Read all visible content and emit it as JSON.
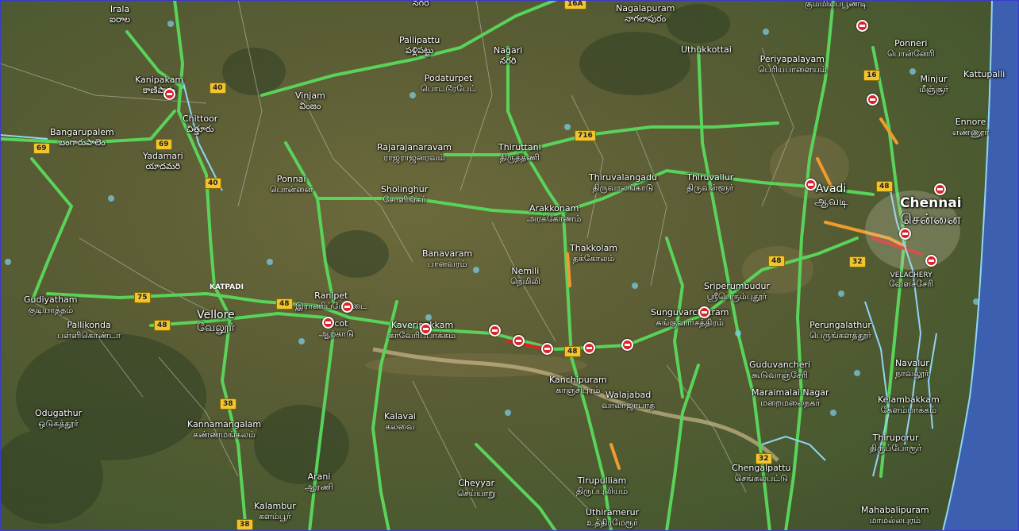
{
  "places": [
    {
      "id": "irala",
      "en": "Irala",
      "ta": "ఐరాల"
    },
    {
      "id": "pallipattu",
      "en": "Pallipattu",
      "ta": "పళ్లిపట్టు"
    },
    {
      "id": "nagari",
      "en": "Nagari",
      "ta": "నగరి"
    },
    {
      "id": "nagari-top",
      "en": "",
      "ta": "నగరి"
    },
    {
      "id": "nagalapuram",
      "en": "Nagalapuram",
      "ta": "నాగలాపురం"
    },
    {
      "id": "uthukkottai",
      "en": "Uthukkottai",
      "ta": ""
    },
    {
      "id": "kummidipundi",
      "en": "",
      "ta": "கும்மிடிப்பூண்டி"
    },
    {
      "id": "ponneri",
      "en": "Ponneri",
      "ta": "பொன்னேரி"
    },
    {
      "id": "periyapalayam",
      "en": "Periyapalayam",
      "ta": "பெரியபாளையம்"
    },
    {
      "id": "minjur",
      "en": "Minjur",
      "ta": "மீஞ்சூர்"
    },
    {
      "id": "kattupalli",
      "en": "Kattupalli",
      "ta": ""
    },
    {
      "id": "ennore",
      "en": "Ennore",
      "ta": "எண்ணூர்"
    },
    {
      "id": "kanipakam",
      "en": "Kanipakam",
      "ta": "కాణిపాకం"
    },
    {
      "id": "vinjam",
      "en": "Vinjam",
      "ta": "వింజం"
    },
    {
      "id": "podaturpet",
      "en": "Podaturpet",
      "ta": "பொடடூரபேட்"
    },
    {
      "id": "chittoor",
      "en": "Chittoor",
      "ta": "చిత్తూరు"
    },
    {
      "id": "bangarupalem",
      "en": "Bangarupalem",
      "ta": "బంగారుపాలెం"
    },
    {
      "id": "yadamari",
      "en": "Yadamari",
      "ta": "యాదమరి"
    },
    {
      "id": "rajarajanaravam",
      "en": "Rajarajanaravam",
      "ta": "ராஜராஜனரவம்"
    },
    {
      "id": "thiruttani",
      "en": "Thiruttani",
      "ta": "திருத்தணி"
    },
    {
      "id": "thiruvalangadu",
      "en": "Thiruvalangadu",
      "ta": "திருவாலங்காடு"
    },
    {
      "id": "thiruvallur",
      "en": "Thiruvallur",
      "ta": "திருவள்ளூர்"
    },
    {
      "id": "avadi",
      "en": "Avadi",
      "ta": "ஆவடி"
    },
    {
      "id": "chennai",
      "en": "Chennai",
      "ta": "சென்னை"
    },
    {
      "id": "ponnai",
      "en": "Ponnai",
      "ta": "பொன்னை"
    },
    {
      "id": "sholinghur",
      "en": "Sholinghur",
      "ta": "சோளிங்கர்"
    },
    {
      "id": "arakkonam",
      "en": "Arakkonam",
      "ta": "அரக்கோணம்"
    },
    {
      "id": "banavaram",
      "en": "Banavaram",
      "ta": "பானவரம்"
    },
    {
      "id": "thakkolam",
      "en": "Thakkolam",
      "ta": "தக்கோலம்"
    },
    {
      "id": "nemili",
      "en": "Nemili",
      "ta": "நெமிலி"
    },
    {
      "id": "sriperumbudur",
      "en": "Sriperumbudur",
      "ta": "ஸ்ரீபெரும்புதூர்"
    },
    {
      "id": "velachery",
      "en": "VELACHERY",
      "ta": "வேளச்சேரி"
    },
    {
      "id": "katpadi",
      "en": "KATPADI",
      "ta": ""
    },
    {
      "id": "gudiyatham",
      "en": "Gudiyatham",
      "ta": "குடியாத்தம்"
    },
    {
      "id": "vellore",
      "en": "Vellore",
      "ta": "வேலூர்"
    },
    {
      "id": "pallikonda",
      "en": "Pallikonda",
      "ta": "பள்ளிகொண்டா"
    },
    {
      "id": "ranipet",
      "en": "Ranipet",
      "ta": "இராணிப்பேட்டை"
    },
    {
      "id": "arcot",
      "en": "Arcot",
      "ta": "ஆற்காடு"
    },
    {
      "id": "kaveripakkam",
      "en": "Kaveripakkam",
      "ta": "காவேரிப்பாக்கம்"
    },
    {
      "id": "sunguvarchatram",
      "en": "Sunguvarchatram",
      "ta": "சுங்குவார்சத்திரம்"
    },
    {
      "id": "perungalathur",
      "en": "Perungalathur",
      "ta": "பெருங்களத்தூர்"
    },
    {
      "id": "navalur",
      "en": "Navalur",
      "ta": "நாவலூர்"
    },
    {
      "id": "kanchipuram",
      "en": "Kanchipuram",
      "ta": "காஞ்சிபுரம்"
    },
    {
      "id": "walajabad",
      "en": "Walajabad",
      "ta": "வாலாஜாபாத்"
    },
    {
      "id": "guduvancheri",
      "en": "Guduvancheri",
      "ta": "கூடுவாஞ்சேரி"
    },
    {
      "id": "maraimalai",
      "en": "Maraimalai Nagar",
      "ta": "மறைமலைநகர்"
    },
    {
      "id": "kelambakkam",
      "en": "Kelambakkam",
      "ta": "கேளம்பாக்கம்"
    },
    {
      "id": "odugathur",
      "en": "Odugathur",
      "ta": "ஒடுகத்தூர்"
    },
    {
      "id": "kannamangalam",
      "en": "Kannamangalam",
      "ta": "கண்ணமங்கலம்"
    },
    {
      "id": "kalavai",
      "en": "Kalavai",
      "ta": "கலவை"
    },
    {
      "id": "thiruporur",
      "en": "Thiruporur",
      "ta": "திருப்போரூர்"
    },
    {
      "id": "chengalpattu",
      "en": "Chengalpattu",
      "ta": "செங்கல்பட்டு"
    },
    {
      "id": "arani",
      "en": "Arani",
      "ta": "ஆரணி"
    },
    {
      "id": "cheyyar",
      "en": "Cheyyar",
      "ta": "செய்யாறு"
    },
    {
      "id": "tirupulliam",
      "en": "Tirupulliam",
      "ta": "திருப்புலியம்"
    },
    {
      "id": "kalambur",
      "en": "Kalambur",
      "ta": "களம்பூர்"
    },
    {
      "id": "uthiramerur",
      "en": "Uthiramerur",
      "ta": "உத்திரமேரூர்"
    },
    {
      "id": "mahabalipuram",
      "en": "Mahabalipuram",
      "ta": "மாமல்லபுரம்"
    }
  ],
  "shields": {
    "r16a": "16A",
    "r40a": "40",
    "r40b": "40",
    "r69a": "69",
    "r69b": "69",
    "r716": "716",
    "r16": "16",
    "r48a": "48",
    "r48b": "48",
    "r48c": "48",
    "r48d": "48",
    "r48e": "48",
    "r32a": "32",
    "r32b": "32",
    "r75": "75",
    "r38a": "38",
    "r38b": "38"
  },
  "colors": {
    "traffic_free": "#5ad35a",
    "traffic_slow": "#f29b2d",
    "traffic_heavy": "#d8232a",
    "incident": "#d8232a",
    "water": "#7fd0f0",
    "sea": "#3f67b8"
  }
}
